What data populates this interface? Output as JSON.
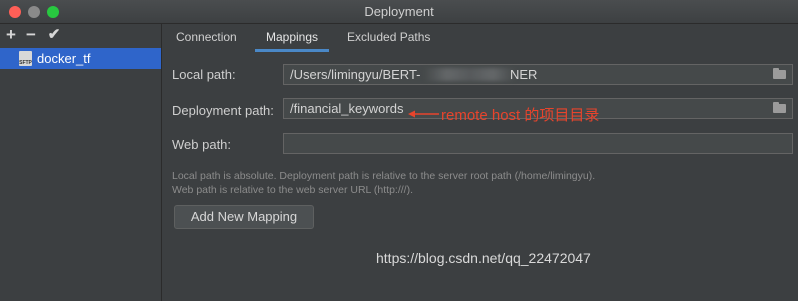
{
  "window": {
    "title": "Deployment"
  },
  "sidebar": {
    "toolbar": {
      "add": "+",
      "remove": "−",
      "check": "✔"
    },
    "servers": [
      {
        "label": "docker_tf",
        "icon_text": "SFTP",
        "selected": true
      }
    ]
  },
  "tabs": [
    {
      "label": "Connection",
      "active": false
    },
    {
      "label": "Mappings",
      "active": true
    },
    {
      "label": "Excluded Paths",
      "active": false
    }
  ],
  "mapping": {
    "local_path": {
      "label": "Local path:",
      "value": "/Users/limingyu/BERT-",
      "value_tail": "NER"
    },
    "deployment_path": {
      "label": "Deployment path:",
      "value": "/financial_keywords"
    },
    "web_path": {
      "label": "Web path:",
      "value": ""
    },
    "hint_line1": "Local path is absolute. Deployment path is relative to the server root path (/home/limingyu).",
    "hint_line2": "Web path is relative to the web server URL (http:///).",
    "add_button": "Add New Mapping"
  },
  "annotation": {
    "text": "remote host 的项目目录",
    "color": "#e8442c"
  },
  "watermark": "https://blog.csdn.net/qq_22472047",
  "colors": {
    "accent": "#2f65ca",
    "tab_underline": "#4a88c7",
    "background": "#3c3f41"
  }
}
